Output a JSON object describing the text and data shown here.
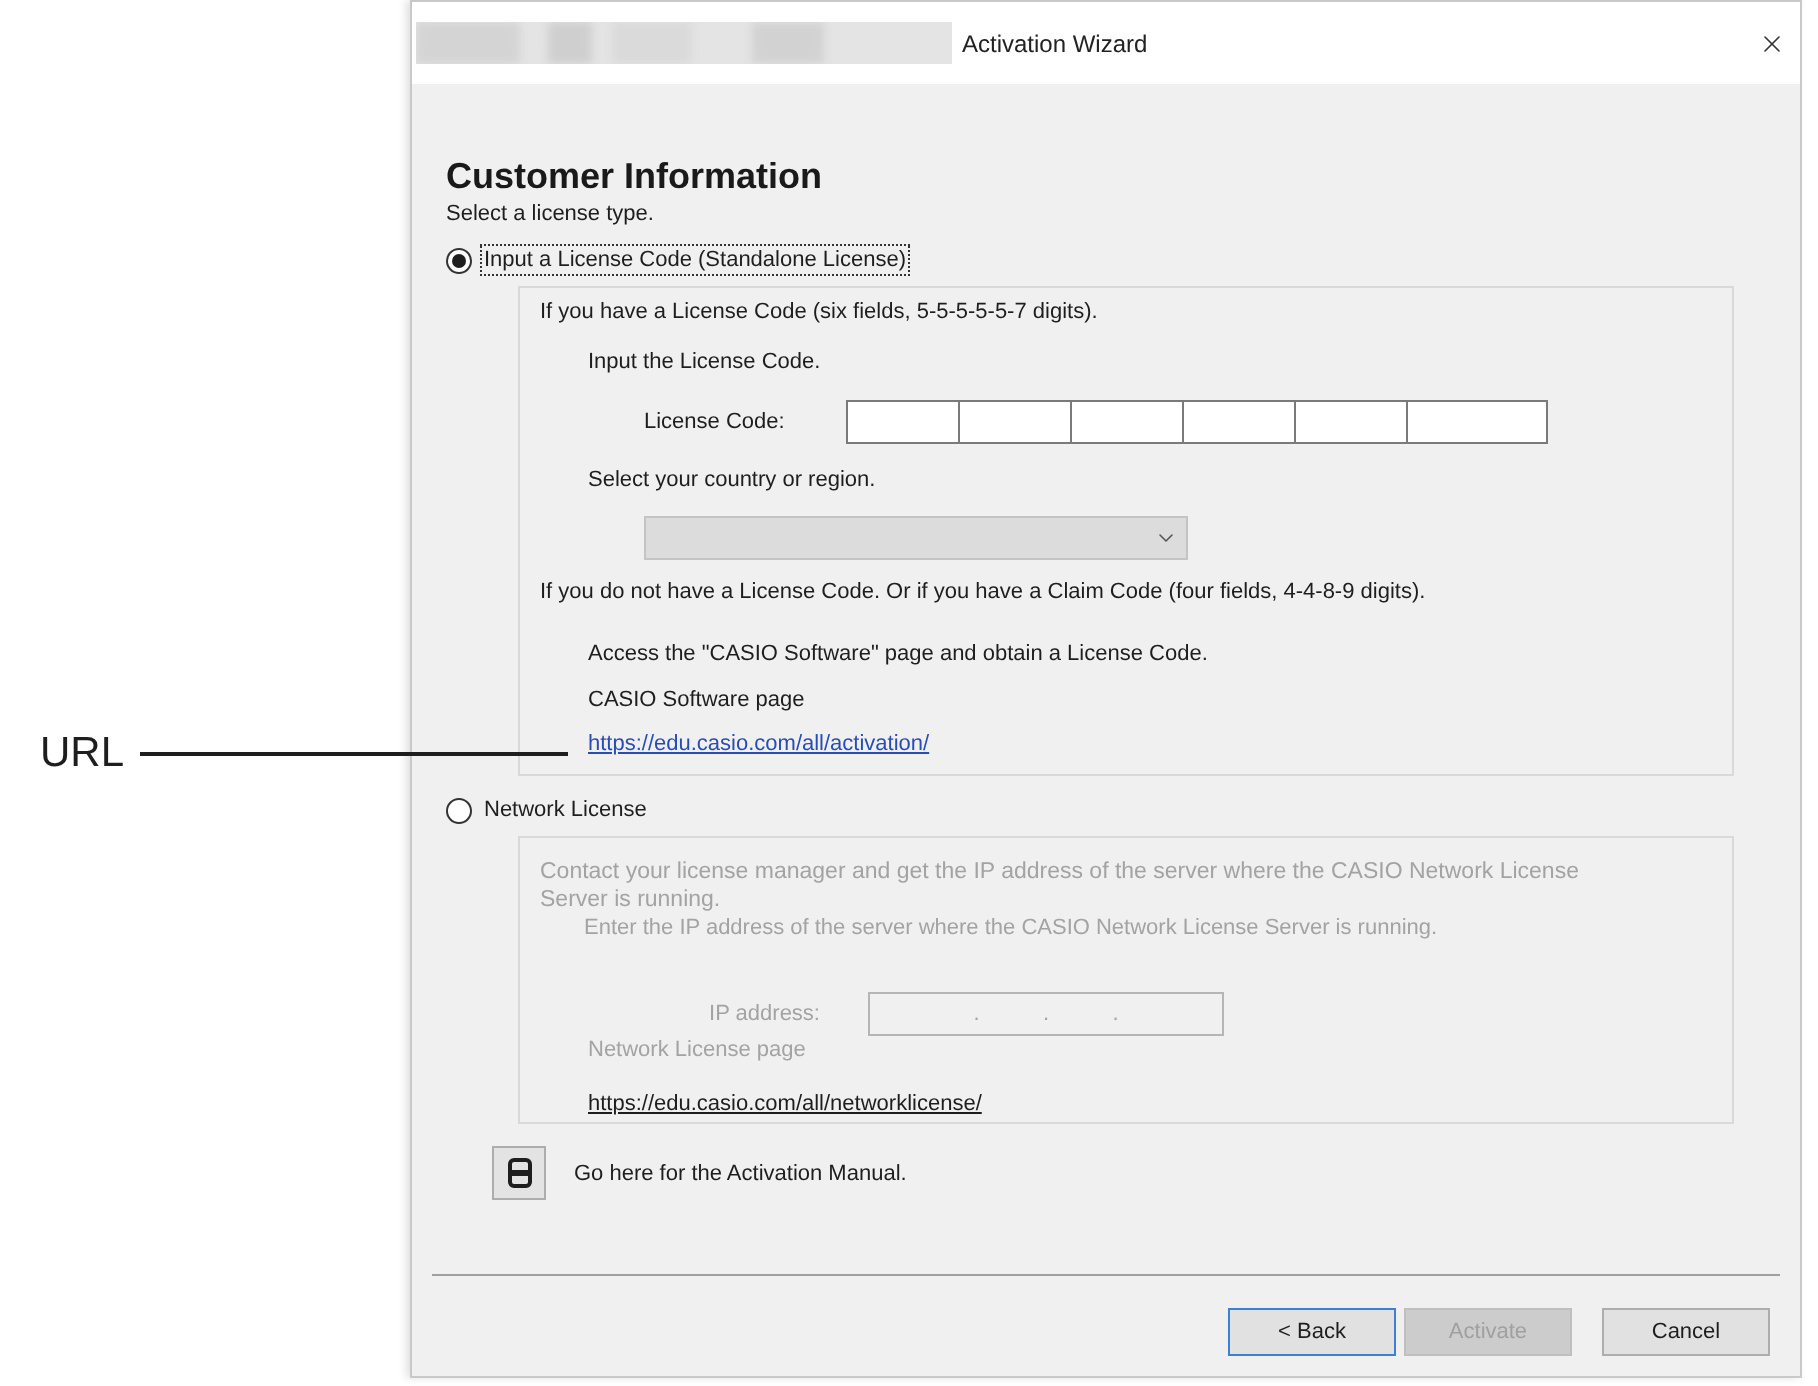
{
  "window": {
    "title": "Activation Wizard"
  },
  "annotation": {
    "label": "URL"
  },
  "heading": "Customer Information",
  "prompt": "Select a license type.",
  "standalone": {
    "label": "Input a License Code (Standalone License)",
    "selected": true,
    "disabled": false,
    "intro": "If you have a License Code (six fields, 5-5-5-5-5-7 digits).",
    "code_prompt": "Input the License Code.",
    "code_label": "License Code:",
    "code_fields": [
      {
        "kind": "short"
      },
      {
        "kind": "short"
      },
      {
        "kind": "short"
      },
      {
        "kind": "short"
      },
      {
        "kind": "short"
      },
      {
        "kind": "long"
      }
    ],
    "country_prompt": "Select your country or region.",
    "country_select": {
      "disabled": true
    },
    "claim_intro": "If you do not have a License Code. Or if you have a Claim Code (four fields, 4-4-8-9 digits).",
    "access_text": "Access the \"CASIO Software\" page and obtain a License Code.",
    "page_label": "CASIO Software page",
    "link": "https://edu.casio.com/all/activation/"
  },
  "network": {
    "label": "Network License",
    "selected": false,
    "disabled": true,
    "intro": "Contact your license manager and get the IP address of the server where the CASIO Network License Server is running.",
    "ip_prompt": "Enter the IP address of the server where the CASIO Network License Server is running.",
    "ip_label": "IP address:",
    "ip_separators": [
      ".",
      ".",
      "."
    ],
    "page_label": "Network License page",
    "link": "https://edu.casio.com/all/networklicense/"
  },
  "manual": {
    "label": "Go here for the Activation Manual."
  },
  "buttons": [
    {
      "label": "< Back",
      "focused": true,
      "disabled": false
    },
    {
      "label": "Activate",
      "focused": false,
      "disabled": true
    },
    {
      "label": "Cancel",
      "focused": false,
      "disabled": false
    }
  ]
}
